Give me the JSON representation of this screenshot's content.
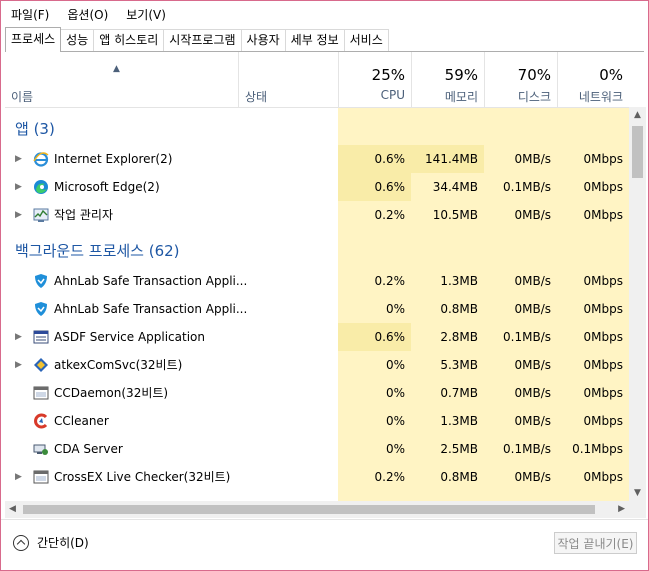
{
  "menu": [
    "파일(F)",
    "옵션(O)",
    "보기(V)"
  ],
  "tabs": [
    "프로세스",
    "성능",
    "앱 히스토리",
    "시작프로그램",
    "사용자",
    "세부 정보",
    "서비스"
  ],
  "header": {
    "name": "이름",
    "status": "상태",
    "cpu": {
      "pct": "25%",
      "label": "CPU"
    },
    "memory": {
      "pct": "59%",
      "label": "메모리"
    },
    "disk": {
      "pct": "70%",
      "label": "디스크"
    },
    "network": {
      "pct": "0%",
      "label": "네트워크"
    }
  },
  "groups": {
    "apps": "앱 (3)",
    "background": "백그라운드 프로세스 (62)"
  },
  "apps": [
    {
      "name": "Internet Explorer(2)",
      "icon": "ie-icon",
      "cpu": "0.6%",
      "mem": "141.4MB",
      "disk": "0MB/s",
      "net": "0Mbps"
    },
    {
      "name": "Microsoft Edge(2)",
      "icon": "edge-icon",
      "cpu": "0.6%",
      "mem": "34.4MB",
      "disk": "0.1MB/s",
      "net": "0Mbps"
    },
    {
      "name": "작업 관리자",
      "icon": "task-manager-icon",
      "cpu": "0.2%",
      "mem": "10.5MB",
      "disk": "0MB/s",
      "net": "0Mbps"
    }
  ],
  "background": [
    {
      "name": "AhnLab Safe Transaction Appli...",
      "icon": "ahnlab-shield-icon",
      "expand": false,
      "cpu": "0.2%",
      "mem": "1.3MB",
      "disk": "0MB/s",
      "net": "0Mbps"
    },
    {
      "name": "AhnLab Safe Transaction Appli...",
      "icon": "ahnlab-shield-icon",
      "expand": false,
      "cpu": "0%",
      "mem": "0.8MB",
      "disk": "0MB/s",
      "net": "0Mbps"
    },
    {
      "name": "ASDF Service Application",
      "icon": "service-window-icon",
      "expand": true,
      "cpu": "0.6%",
      "mem": "2.8MB",
      "disk": "0.1MB/s",
      "net": "0Mbps"
    },
    {
      "name": "atkexComSvc(32비트)",
      "icon": "atkex-diamond-icon",
      "expand": true,
      "cpu": "0%",
      "mem": "5.3MB",
      "disk": "0MB/s",
      "net": "0Mbps"
    },
    {
      "name": "CCDaemon(32비트)",
      "icon": "generic-window-icon",
      "expand": false,
      "cpu": "0%",
      "mem": "0.7MB",
      "disk": "0MB/s",
      "net": "0Mbps"
    },
    {
      "name": "CCleaner",
      "icon": "ccleaner-icon",
      "expand": false,
      "cpu": "0%",
      "mem": "1.3MB",
      "disk": "0MB/s",
      "net": "0Mbps"
    },
    {
      "name": "CDA Server",
      "icon": "cda-server-icon",
      "expand": false,
      "cpu": "0%",
      "mem": "2.5MB",
      "disk": "0.1MB/s",
      "net": "0.1Mbps"
    },
    {
      "name": "CrossEX Live Checker(32비트)",
      "icon": "generic-window-icon",
      "expand": true,
      "cpu": "0.2%",
      "mem": "0.8MB",
      "disk": "0MB/s",
      "net": "0Mbps"
    }
  ],
  "footer": {
    "collapse": "간단히(D)",
    "end_task": "작업 끝내기(E)"
  },
  "colors": {
    "group_title": "#1e57a4",
    "heat": "#fff4c4",
    "heat_dark": "#f9eca8"
  }
}
